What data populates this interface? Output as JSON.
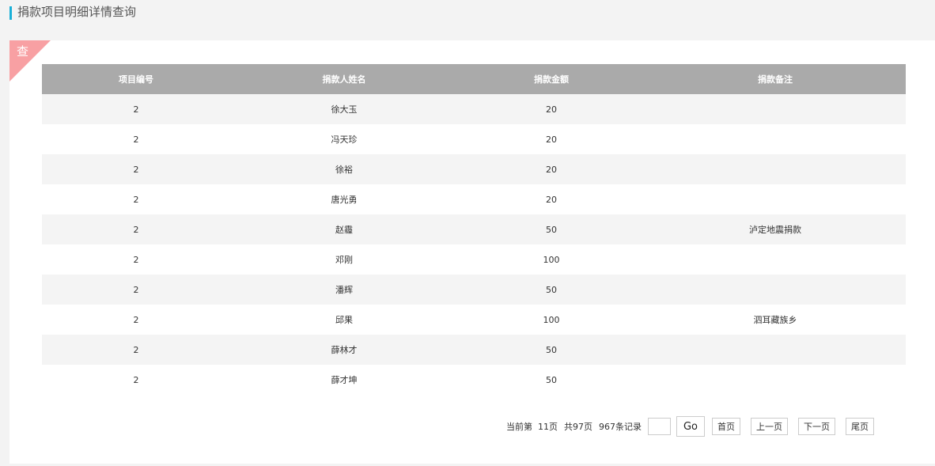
{
  "header": {
    "title": "捐款项目明细详情查询"
  },
  "panel": {
    "corner_label": "查"
  },
  "table": {
    "columns": [
      "项目编号",
      "捐款人姓名",
      "捐款金额",
      "捐款备注"
    ],
    "rows": [
      [
        "2",
        "徐大玉",
        "20",
        ""
      ],
      [
        "2",
        "冯天珍",
        "20",
        ""
      ],
      [
        "2",
        "徐裕",
        "20",
        ""
      ],
      [
        "2",
        "唐光勇",
        "20",
        ""
      ],
      [
        "2",
        "赵霾",
        "50",
        "泸定地震捐款"
      ],
      [
        "2",
        "邓刚",
        "100",
        ""
      ],
      [
        "2",
        "潘辉",
        "50",
        ""
      ],
      [
        "2",
        "邱果",
        "100",
        "泗耳藏族乡"
      ],
      [
        "2",
        "薛林才",
        "50",
        ""
      ],
      [
        "2",
        "薛才坤",
        "50",
        ""
      ]
    ]
  },
  "pager": {
    "current": "当前第  11页",
    "total_pages": "共97页",
    "total_records": "967条记录",
    "input_value": "",
    "go_label": "Go",
    "first_label": "首页",
    "prev_label": "上一页",
    "next_label": "下一页",
    "last_label": "尾页"
  }
}
